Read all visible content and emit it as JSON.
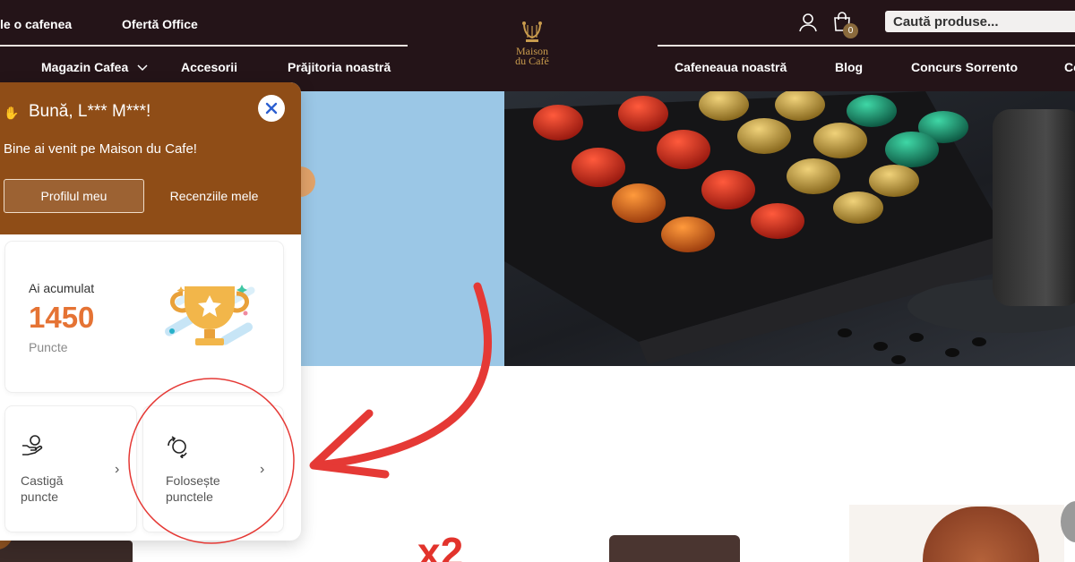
{
  "header": {
    "top_links": [
      "le o cafenea",
      "Ofertă Office"
    ],
    "nav_left": [
      "Magazin Cafea",
      "Accesorii",
      "Prăjitoria noastră"
    ],
    "nav_right": [
      "Cafeneaua noastră",
      "Blog",
      "Concurs Sorrento",
      "Co"
    ],
    "logo": {
      "line1": "Maison",
      "line2": "du Café"
    },
    "cart_count": "0",
    "search_placeholder": "Caută produse..."
  },
  "panel": {
    "greeting": "Bună, L*** M***!",
    "welcome": "Bine ai venit pe Maison du Cafe!",
    "profile_button": "Profilul meu",
    "reviews_button": "Recenziile mele",
    "points_label": "Ai acumulat",
    "points_value": "1450",
    "points_unit": "Puncte",
    "earn": {
      "line1": "Castigă",
      "line2": "puncte"
    },
    "use": {
      "line1": "Folosește",
      "line2": "punctele"
    }
  },
  "promo": {
    "badge": "x2"
  },
  "colors": {
    "header_bg": "#241418",
    "panel_brown": "#8f4d17",
    "points_orange": "#e57334",
    "annotation_red": "#e53935",
    "hero_blue": "#9bc7e6",
    "logo_gold": "#c89b4d"
  }
}
